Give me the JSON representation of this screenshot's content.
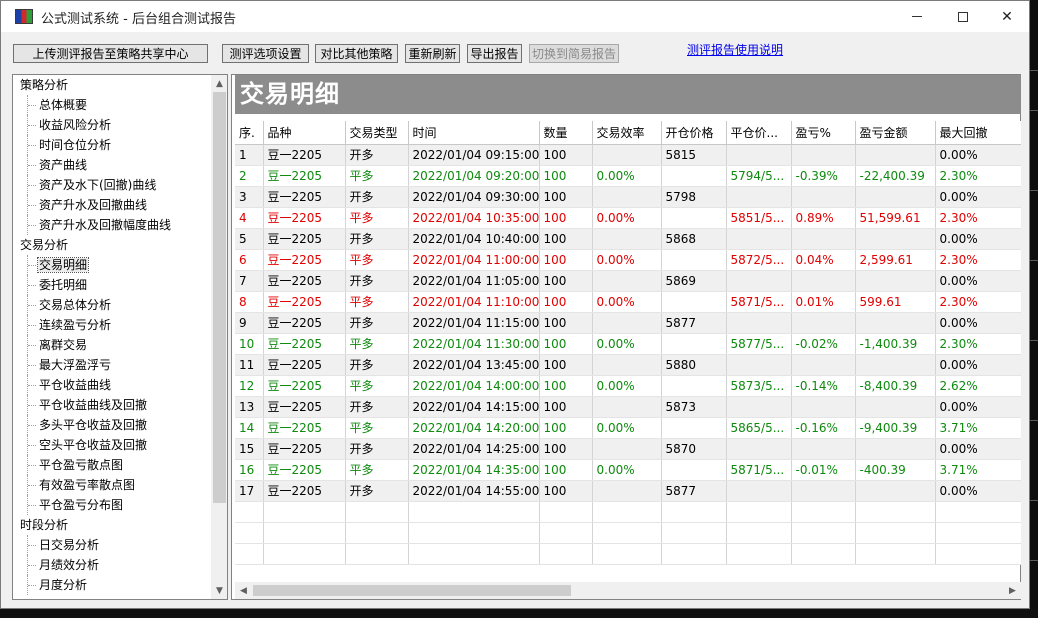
{
  "window": {
    "title": "公式测试系统 - 后台组合测试报告"
  },
  "toolbar": {
    "upload_label": "上传测评报告至策略共享中心",
    "options_label": "测评选项设置",
    "compare_label": "对比其他策略",
    "refresh_label": "重新刷新",
    "export_label": "导出报告",
    "simple_label": "切换到简易报告",
    "help_label": "测评报告使用说明"
  },
  "tree": [
    {
      "label": "策略分析",
      "type": "group"
    },
    {
      "label": "总体概要",
      "type": "child"
    },
    {
      "label": "收益风险分析",
      "type": "child"
    },
    {
      "label": "时间仓位分析",
      "type": "child"
    },
    {
      "label": "资产曲线",
      "type": "child"
    },
    {
      "label": "资产及水下(回撤)曲线",
      "type": "child"
    },
    {
      "label": "资产升水及回撤曲线",
      "type": "child"
    },
    {
      "label": "资产升水及回撤幅度曲线",
      "type": "child"
    },
    {
      "label": "交易分析",
      "type": "group"
    },
    {
      "label": "交易明细",
      "type": "child",
      "selected": true
    },
    {
      "label": "委托明细",
      "type": "child"
    },
    {
      "label": "交易总体分析",
      "type": "child"
    },
    {
      "label": "连续盈亏分析",
      "type": "child"
    },
    {
      "label": "离群交易",
      "type": "child"
    },
    {
      "label": "最大浮盈浮亏",
      "type": "child"
    },
    {
      "label": "平仓收益曲线",
      "type": "child"
    },
    {
      "label": "平仓收益曲线及回撤",
      "type": "child"
    },
    {
      "label": "多头平仓收益及回撤",
      "type": "child"
    },
    {
      "label": "空头平仓收益及回撤",
      "type": "child"
    },
    {
      "label": "平仓盈亏散点图",
      "type": "child"
    },
    {
      "label": "有效盈亏率散点图",
      "type": "child"
    },
    {
      "label": "平仓盈亏分布图",
      "type": "child"
    },
    {
      "label": "时段分析",
      "type": "group"
    },
    {
      "label": "日交易分析",
      "type": "child"
    },
    {
      "label": "月绩效分析",
      "type": "child"
    },
    {
      "label": "月度分析",
      "type": "child"
    }
  ],
  "report": {
    "title": "交易明细",
    "columns": [
      "序.",
      "品种",
      "交易类型",
      "时间",
      "数量",
      "交易效率",
      "开仓价格",
      "平仓价...",
      "盈亏%",
      "盈亏金额",
      "最大回撤"
    ],
    "rows": [
      {
        "cells": [
          "1",
          "豆一2205",
          "开多",
          "2022/01/04 09:15:00",
          "100",
          "",
          "5815",
          "",
          "",
          "",
          "0.00%"
        ],
        "color": "black"
      },
      {
        "cells": [
          "2",
          "豆一2205",
          "平多",
          "2022/01/04 09:20:00",
          "100",
          "0.00%",
          "",
          "5794/5...",
          "-0.39%",
          "-22,400.39",
          "2.30%"
        ],
        "color": "green"
      },
      {
        "cells": [
          "3",
          "豆一2205",
          "开多",
          "2022/01/04 09:30:00",
          "100",
          "",
          "5798",
          "",
          "",
          "",
          "0.00%"
        ],
        "color": "black"
      },
      {
        "cells": [
          "4",
          "豆一2205",
          "平多",
          "2022/01/04 10:35:00",
          "100",
          "0.00%",
          "",
          "5851/5...",
          "0.89%",
          "51,599.61",
          "2.30%"
        ],
        "color": "red"
      },
      {
        "cells": [
          "5",
          "豆一2205",
          "开多",
          "2022/01/04 10:40:00",
          "100",
          "",
          "5868",
          "",
          "",
          "",
          "0.00%"
        ],
        "color": "black"
      },
      {
        "cells": [
          "6",
          "豆一2205",
          "平多",
          "2022/01/04 11:00:00",
          "100",
          "0.00%",
          "",
          "5872/5...",
          "0.04%",
          "2,599.61",
          "2.30%"
        ],
        "color": "red"
      },
      {
        "cells": [
          "7",
          "豆一2205",
          "开多",
          "2022/01/04 11:05:00",
          "100",
          "",
          "5869",
          "",
          "",
          "",
          "0.00%"
        ],
        "color": "black"
      },
      {
        "cells": [
          "8",
          "豆一2205",
          "平多",
          "2022/01/04 11:10:00",
          "100",
          "0.00%",
          "",
          "5871/5...",
          "0.01%",
          "599.61",
          "2.30%"
        ],
        "color": "red"
      },
      {
        "cells": [
          "9",
          "豆一2205",
          "开多",
          "2022/01/04 11:15:00",
          "100",
          "",
          "5877",
          "",
          "",
          "",
          "0.00%"
        ],
        "color": "black"
      },
      {
        "cells": [
          "10",
          "豆一2205",
          "平多",
          "2022/01/04 11:30:00",
          "100",
          "0.00%",
          "",
          "5877/5...",
          "-0.02%",
          "-1,400.39",
          "2.30%"
        ],
        "color": "green"
      },
      {
        "cells": [
          "11",
          "豆一2205",
          "开多",
          "2022/01/04 13:45:00",
          "100",
          "",
          "5880",
          "",
          "",
          "",
          "0.00%"
        ],
        "color": "black"
      },
      {
        "cells": [
          "12",
          "豆一2205",
          "平多",
          "2022/01/04 14:00:00",
          "100",
          "0.00%",
          "",
          "5873/5...",
          "-0.14%",
          "-8,400.39",
          "2.62%"
        ],
        "color": "green"
      },
      {
        "cells": [
          "13",
          "豆一2205",
          "开多",
          "2022/01/04 14:15:00",
          "100",
          "",
          "5873",
          "",
          "",
          "",
          "0.00%"
        ],
        "color": "black"
      },
      {
        "cells": [
          "14",
          "豆一2205",
          "平多",
          "2022/01/04 14:20:00",
          "100",
          "0.00%",
          "",
          "5865/5...",
          "-0.16%",
          "-9,400.39",
          "3.71%"
        ],
        "color": "green"
      },
      {
        "cells": [
          "15",
          "豆一2205",
          "开多",
          "2022/01/04 14:25:00",
          "100",
          "",
          "5870",
          "",
          "",
          "",
          "0.00%"
        ],
        "color": "black"
      },
      {
        "cells": [
          "16",
          "豆一2205",
          "平多",
          "2022/01/04 14:35:00",
          "100",
          "0.00%",
          "",
          "5871/5...",
          "-0.01%",
          "-400.39",
          "3.71%"
        ],
        "color": "green"
      },
      {
        "cells": [
          "17",
          "豆一2205",
          "开多",
          "2022/01/04 14:55:00",
          "100",
          "",
          "5877",
          "",
          "",
          "",
          "0.00%"
        ],
        "color": "black"
      }
    ]
  },
  "colors": {
    "profit_red": "#e00000",
    "loss_green": "#0e8a0e",
    "banner_gray": "#8c8c8c"
  }
}
